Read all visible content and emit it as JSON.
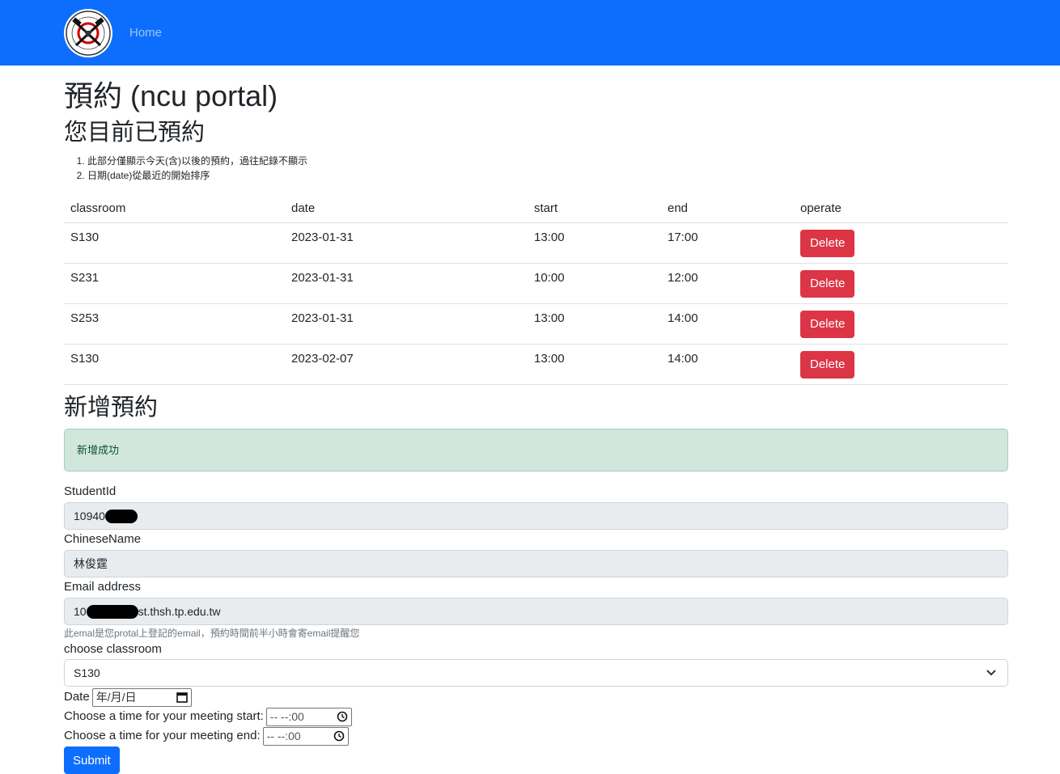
{
  "nav": {
    "home_label": "Home"
  },
  "page": {
    "title": "預約 (ncu portal)"
  },
  "reservations": {
    "section_title": "您目前已預約",
    "notes": [
      "此部分僅顯示今天(含)以後的預約，過往紀錄不顯示",
      "日期(date)從最近的開始排序"
    ],
    "columns": [
      "classroom",
      "date",
      "start",
      "end",
      "operate"
    ],
    "rows": [
      {
        "classroom": "S130",
        "date": "2023-01-31",
        "start": "13:00",
        "end": "17:00",
        "action": "Delete"
      },
      {
        "classroom": "S231",
        "date": "2023-01-31",
        "start": "10:00",
        "end": "12:00",
        "action": "Delete"
      },
      {
        "classroom": "S253",
        "date": "2023-01-31",
        "start": "13:00",
        "end": "14:00",
        "action": "Delete"
      },
      {
        "classroom": "S130",
        "date": "2023-02-07",
        "start": "13:00",
        "end": "14:00",
        "action": "Delete"
      }
    ]
  },
  "new_reservation": {
    "section_title": "新增預約",
    "alert": "新增成功",
    "student_id_label": "StudentId",
    "student_id_value": "10940",
    "chinese_name_label": "ChineseName",
    "chinese_name_value": "林俊霆",
    "email_label": "Email address",
    "email_prefix": "10",
    "email_suffix": "st.thsh.tp.edu.tw",
    "email_help": "此emal是您protal上登記的email，預約時間前半小時會寄email提醒您",
    "classroom_label": "choose classroom",
    "classroom_value": "S130",
    "date_label": "Date",
    "date_placeholder": "年/月/日",
    "start_label": "Choose a time for your meeting start:",
    "start_placeholder": "-- --:00",
    "end_label": "Choose a time for your meeting end:",
    "end_placeholder": "-- --:00",
    "submit_label": "Submit"
  },
  "colors": {
    "navbar": "#0d6efd",
    "danger": "#dc3545",
    "success_bg": "#d1e7dd",
    "primary": "#0d6efd"
  }
}
